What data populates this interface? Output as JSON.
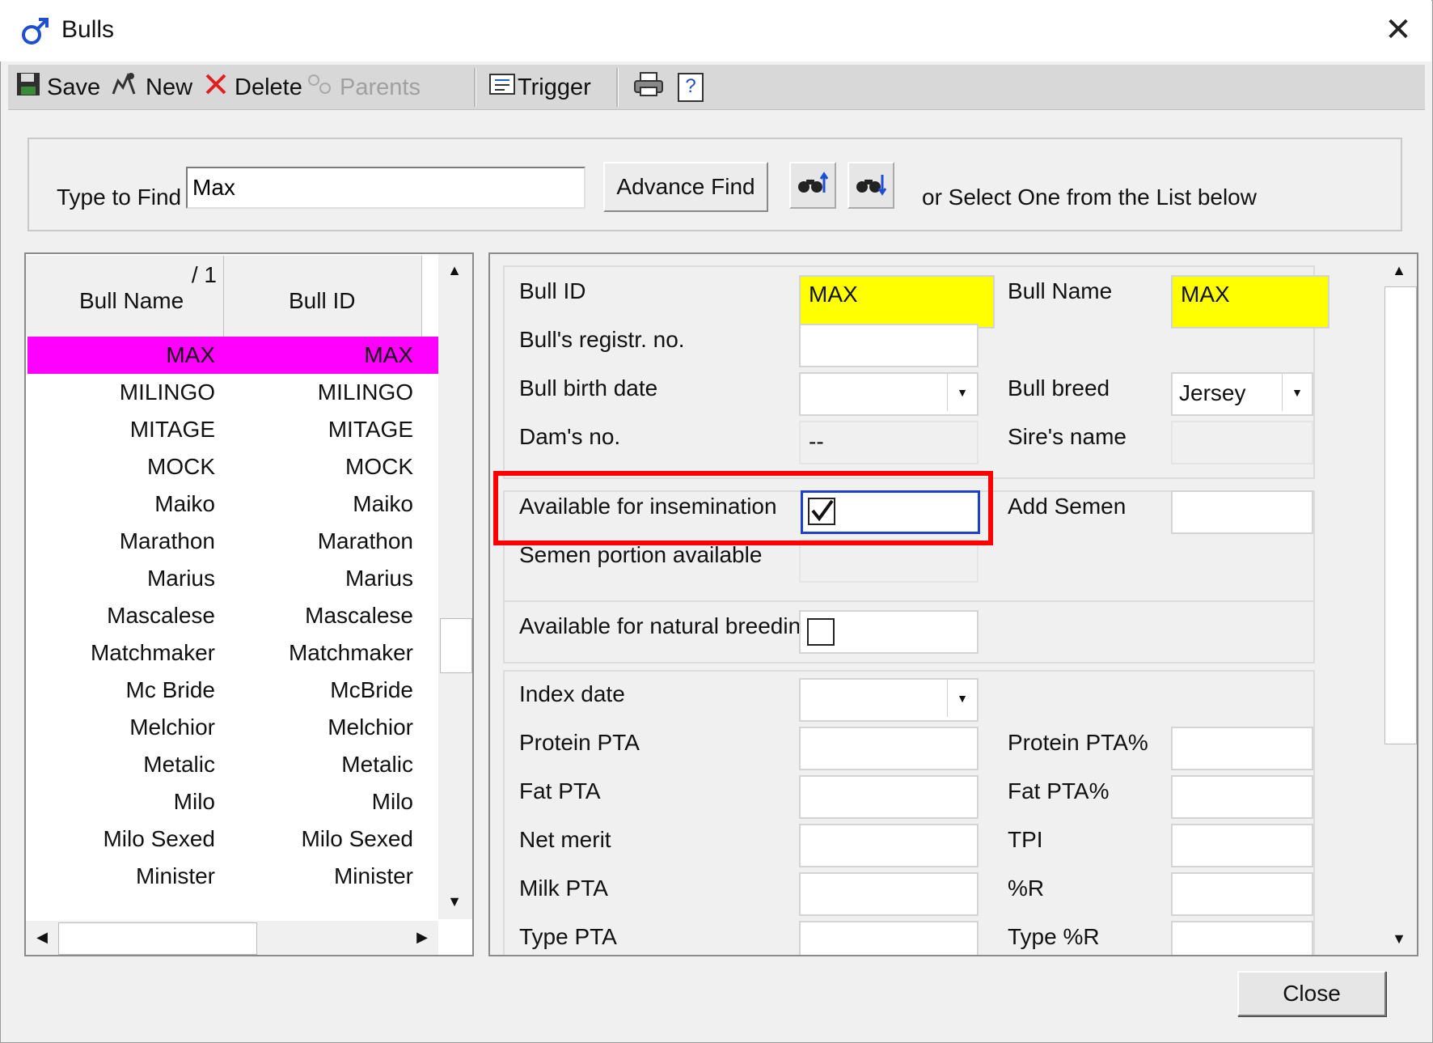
{
  "window": {
    "title": "Bulls",
    "title_icon": "male-symbol-icon",
    "close_glyph": "✕"
  },
  "toolbar": {
    "save": "Save",
    "new": "New",
    "delete": "Delete",
    "parents": "Parents",
    "trigger": "Trigger",
    "help_glyph": "?"
  },
  "find": {
    "label": "Type to Find",
    "value": "Max",
    "advance_find": "Advance Find",
    "hint": "or Select One from the List below"
  },
  "list": {
    "sort_indicator": "/ 1",
    "columns": [
      "Bull Name",
      "Bull ID"
    ],
    "rows": [
      [
        "MAX",
        "MAX"
      ],
      [
        "MILINGO",
        "MILINGO"
      ],
      [
        "MITAGE",
        "MITAGE"
      ],
      [
        "MOCK",
        "MOCK"
      ],
      [
        "Maiko",
        "Maiko"
      ],
      [
        "Marathon",
        "Marathon"
      ],
      [
        "Marius",
        "Marius"
      ],
      [
        "Mascalese",
        "Mascalese"
      ],
      [
        "Matchmaker",
        "Matchmaker"
      ],
      [
        "Mc Bride",
        "McBride"
      ],
      [
        "Melchior",
        "Melchior"
      ],
      [
        "Metalic",
        "Metalic"
      ],
      [
        "Milo",
        "Milo"
      ],
      [
        "Milo Sexed",
        "Milo Sexed"
      ],
      [
        "Minister",
        "Minister"
      ]
    ],
    "selected_index": 0
  },
  "detail": {
    "bull_id_label": "Bull ID",
    "bull_id_value": "MAX",
    "bull_name_label": "Bull Name",
    "bull_name_value": "MAX",
    "registr_label": "Bull's registr. no.",
    "birth_label": "Bull birth date",
    "breed_label": "Bull breed",
    "breed_value": "Jersey",
    "dam_label": "Dam's no.",
    "dam_value": "--",
    "sire_label": "Sire's name",
    "insem_label": "Available for insemination",
    "insem_checked": true,
    "add_semen_label": "Add Semen",
    "semen_portion_label": "Semen portion available",
    "natural_label": "Available for natural breeding",
    "natural_checked": false,
    "index_date_label": "Index date",
    "protein_pta_label": "Protein PTA",
    "protein_pta_pct_label": "Protein PTA%",
    "fat_pta_label": "Fat PTA",
    "fat_pta_pct_label": "Fat PTA%",
    "net_merit_label": "Net merit",
    "tpi_label": "TPI",
    "milk_pta_label": "Milk PTA",
    "pct_r_label": "%R",
    "type_pta_label": "Type PTA",
    "type_pct_r_label": "Type %R"
  },
  "footer": {
    "close": "Close"
  },
  "colors": {
    "selection": "#ff00ff",
    "key_field": "#ffff00",
    "highlight": "#ff0000",
    "focus": "#1f3fcf"
  }
}
